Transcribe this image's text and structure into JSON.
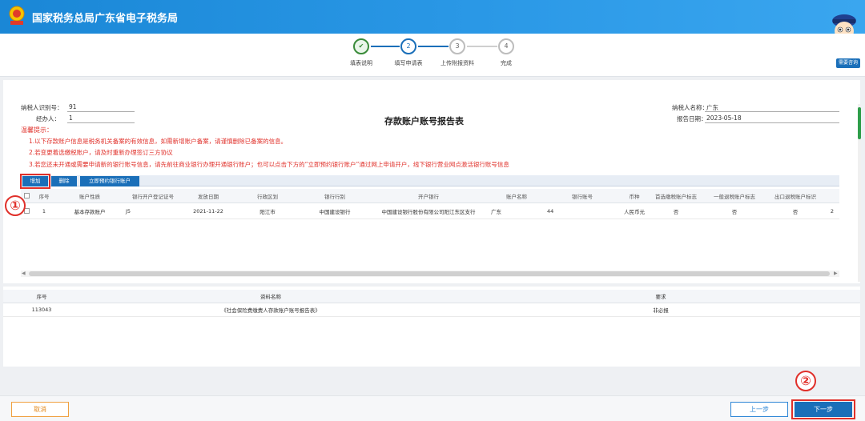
{
  "header": {
    "title": "国家税务总局广东省电子税务局",
    "brand_color": "#1a87d6"
  },
  "steps": [
    {
      "label": "填表说明",
      "state": "done",
      "num": "✔"
    },
    {
      "label": "填写申请表",
      "state": "active",
      "num": "2"
    },
    {
      "label": "上传附报资料",
      "state": "pending",
      "num": "3"
    },
    {
      "label": "完成",
      "state": "pending",
      "num": "4"
    }
  ],
  "help": {
    "label": "需要咨询"
  },
  "form": {
    "title": "存款账户账号报告表",
    "taxpayer_id_label": "纳税人识别号：",
    "taxpayer_id_value": "91",
    "agent_label": "经办人：",
    "agent_value": "1",
    "taxpayer_name_label": "纳税人名称：",
    "taxpayer_name_value": "广东",
    "report_date_label": "报告日期：",
    "report_date_value": "2023-05-18"
  },
  "tips": {
    "title": "温馨提示：",
    "items": [
      "1.以下存款账户信息是税务机关备案的有效信息，如需新增账户备案，请谨慎删除已备案的信息。",
      "2.若变更着选缴税账户，请及时重新办理签订三方协议",
      "3.若您还未开通或需要申请新的银行账号信息，请先前往商业银行办理开通银行账户；也可以点击下方的“立即预约银行账户”通过网上申请开户，线下银行营业网点激活银行账号信息"
    ]
  },
  "toolbar": {
    "add_label": "增加",
    "delete_label": "删除",
    "reserve_label": "立即预约银行账户"
  },
  "markers": {
    "m1": "①",
    "m2": "②"
  },
  "accounts_table": {
    "columns": [
      "序号",
      "账户性质",
      "银行开户登记证号",
      "发放日期",
      "行政区划",
      "银行行别",
      "开户银行",
      "账户名称",
      "银行账号",
      "币种",
      "首选缴税账户标志",
      "一般退税账户标志",
      "出口退税账户标识"
    ],
    "rows": [
      {
        "cells": [
          "1",
          "基本存款账户",
          "J5",
          "2021-11-22",
          "阳江市",
          "中国建设银行",
          "中国建设银行股份有限公司阳江东区支行",
          "广东",
          "44",
          "人民币元",
          "否",
          "否",
          "否"
        ],
        "overflow": "2"
      }
    ]
  },
  "attachments_table": {
    "columns": [
      "序号",
      "资料名称",
      "要求"
    ],
    "rows": [
      {
        "cells": [
          "113043",
          "《社会保险费缴费人存款账户账号报告表》",
          "非必报"
        ]
      }
    ]
  },
  "footer": {
    "cancel_label": "取消",
    "prev_label": "上一步",
    "next_label": "下一步"
  }
}
